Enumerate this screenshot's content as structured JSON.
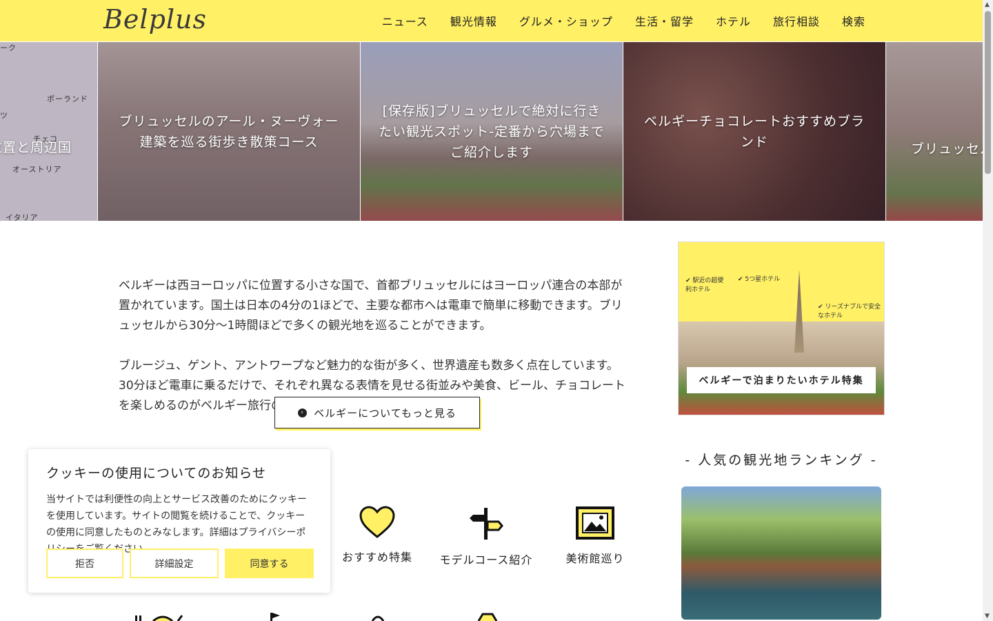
{
  "header": {
    "logo": "Belplus",
    "nav": [
      "ニュース",
      "観光情報",
      "グルメ・ショップ",
      "生活・留学",
      "ホテル",
      "旅行相談",
      "検索"
    ]
  },
  "slider": {
    "slides": [
      {
        "title": "ベルギーの位置と周辺国"
      },
      {
        "title": "ブリュッセルのアール・ヌーヴォー建築を巡る街歩き散策コース"
      },
      {
        "title": "[保存版]ブリュッセルで絶対に行きたい観光スポット-定番から穴場までご紹介します"
      },
      {
        "title": "ベルギーチョコレートおすすめブランド"
      },
      {
        "title": "ブリュッセルのおすすめホテル特集"
      }
    ],
    "map_labels": [
      "ーク",
      "ポーランド",
      "ツ",
      "チェコ",
      "オーストリア",
      "イタリア"
    ]
  },
  "intro": {
    "paragraph1": "ベルギーは西ヨーロッパに位置する小さな国で、首都ブリュッセルにはヨーロッパ連合の本部が置かれています。国土は日本の4分の1ほどで、主要な都市へは電車で簡単に移動できます。ブリュッセルから30分～1時間ほどで多くの観光地を巡ることができます。",
    "paragraph2": "ブルージュ、ゲント、アントワープなど魅力的な街が多く、世界遺産も数多く点在しています。30分ほど電車に乗るだけで、それぞれ異なる表情を見せる街並みや美食、ビール、チョコレートを楽しめるのがベルギー旅行の魅力です。",
    "cta_label": "ベルギーについてもっと見る"
  },
  "categories": [
    {
      "label": "おすすめ特集",
      "icon": "heart-icon"
    },
    {
      "label": "モデルコース紹介",
      "icon": "signpost-icon"
    },
    {
      "label": "美術館巡り",
      "icon": "picture-frame-icon"
    }
  ],
  "sidebar": {
    "banner": {
      "notes": [
        "✔ 駅近の超便利ホテル",
        "✔ 5つ星ホテル",
        "✔ リーズナブルで安全なホテル"
      ],
      "caption": "ベルギーで泊まりたいホテル特集"
    },
    "heading": "人気の観光地ランキング"
  },
  "cookie": {
    "title": "クッキーの使用についてのお知らせ",
    "text": "当サイトでは利便性の向上とサービス改善のためにクッキーを使用しています。サイトの閲覧を続けることで、クッキーの使用に同意したものとみなします。詳細はプライバシーポリシーをご覧ください。",
    "buttons": [
      "拒否",
      "詳細設定",
      "同意する"
    ]
  },
  "colors": {
    "accent": "#fff066",
    "text": "#222222"
  }
}
